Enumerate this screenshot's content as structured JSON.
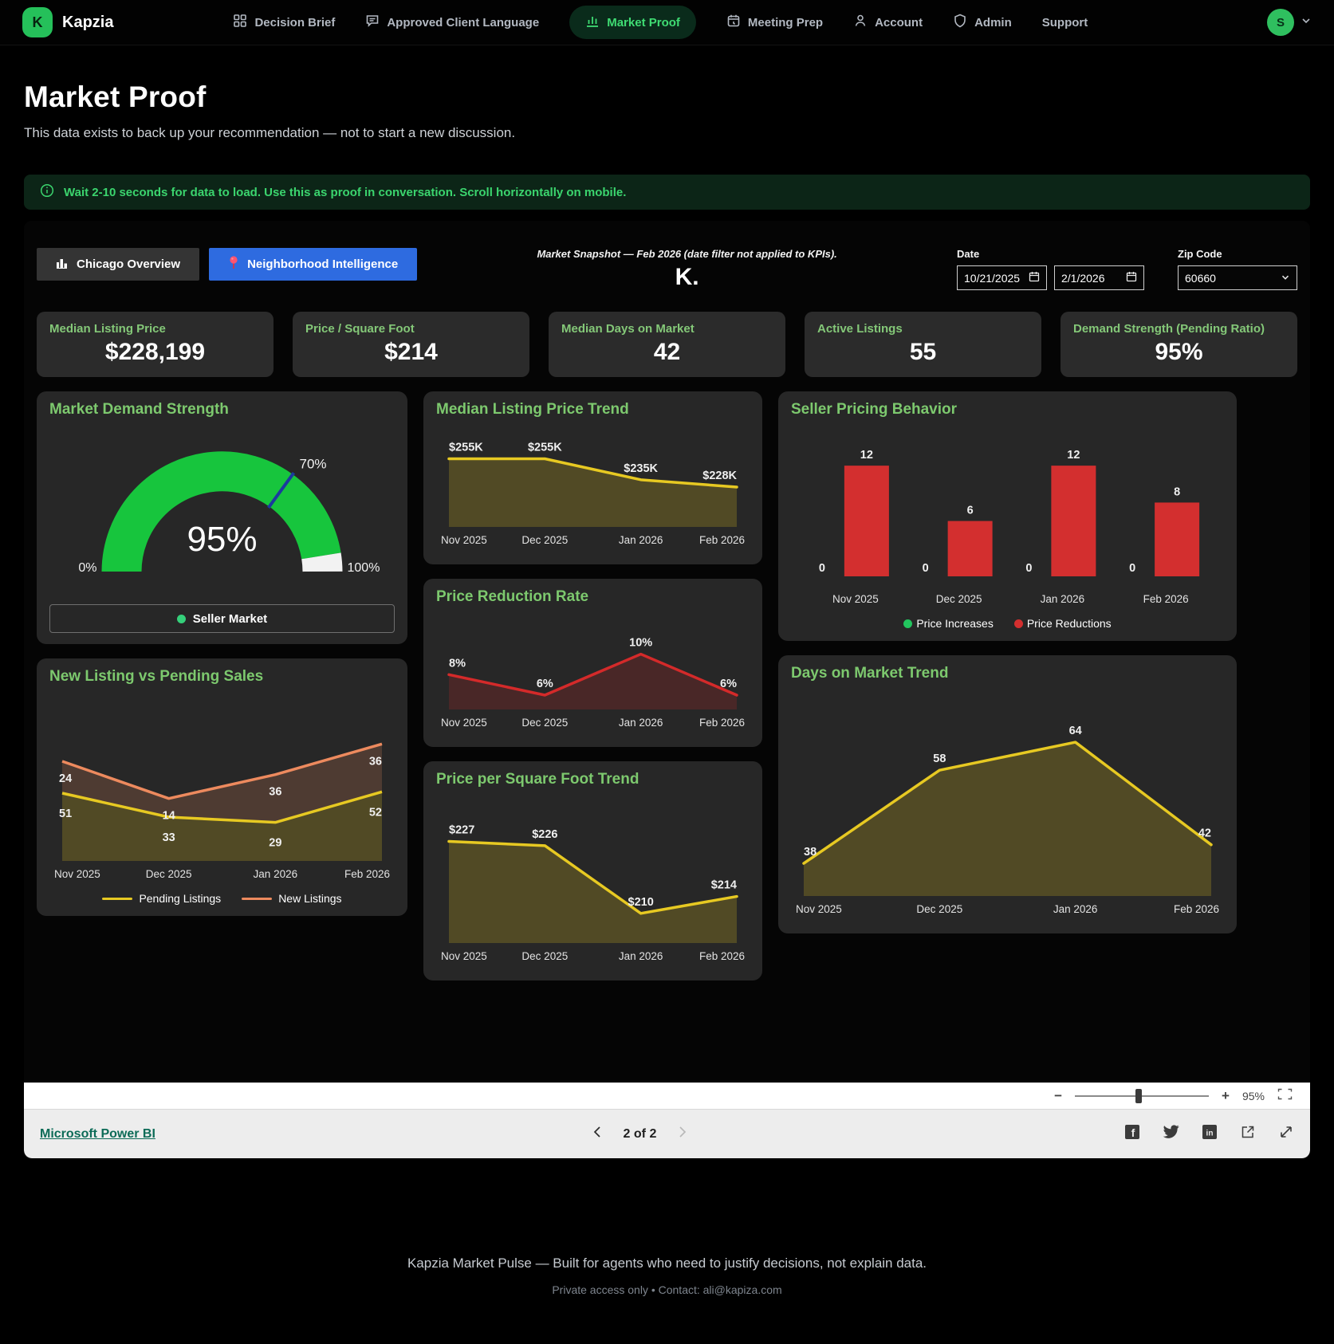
{
  "nav": {
    "brand": "Kapzia",
    "brand_initial": "K",
    "items": [
      {
        "label": "Decision Brief"
      },
      {
        "label": "Approved Client Language"
      },
      {
        "label": "Market Proof",
        "active": true
      },
      {
        "label": "Meeting Prep"
      },
      {
        "label": "Account"
      },
      {
        "label": "Admin"
      },
      {
        "label": "Support"
      }
    ],
    "avatar_initial": "S"
  },
  "header": {
    "title": "Market Proof",
    "subtitle": "This data exists to back up your recommendation — not to start a new discussion."
  },
  "banner": {
    "text": "Wait 2-10 seconds for data to load. Use this as proof in conversation. Scroll horizontally on mobile."
  },
  "report": {
    "tabs": [
      {
        "label": "Chicago Overview"
      },
      {
        "label": "Neighborhood Intelligence",
        "active": true
      }
    ],
    "snapshot_caption": "Market Snapshot — Feb 2026 (date filter not applied to KPIs).",
    "snapshot_mark": "K.",
    "filters": {
      "date_label": "Date",
      "date_from": "10/21/2025",
      "date_to": "2/1/2026",
      "zip_label": "Zip Code",
      "zip_value": "60660"
    },
    "kpis": [
      {
        "label": "Median Listing Price",
        "value": "$228,199"
      },
      {
        "label": "Price / Square Foot",
        "value": "$214"
      },
      {
        "label": "Median Days on Market",
        "value": "42"
      },
      {
        "label": "Active Listings",
        "value": "55"
      },
      {
        "label": "Demand Strength (Pending Ratio)",
        "value": "95%"
      }
    ]
  },
  "chart_data": [
    {
      "id": "gauge",
      "type": "gauge",
      "title": "Market Demand Strength",
      "value": 95,
      "target": 70,
      "value_label": "95%",
      "target_label": "70%",
      "min_label": "0%",
      "max_label": "100%",
      "legend": "Seller Market",
      "color": "#17c53d",
      "rest_color": "#f2f2f2",
      "target_color": "#1b3a9e"
    },
    {
      "id": "median-price",
      "type": "area",
      "title": "Median Listing Price Trend",
      "x": [
        "Nov 2025",
        "Dec 2025",
        "Jan 2026",
        "Feb 2026"
      ],
      "values": [
        255,
        255,
        235,
        228
      ],
      "labels": [
        "$255K",
        "$255K",
        "$235K",
        "$228K"
      ],
      "ylim": [
        190,
        263
      ],
      "color": "#e7c922",
      "fill": "rgba(231,201,34,0.22)"
    },
    {
      "id": "seller-pricing",
      "type": "bar",
      "title": "Seller Pricing Behavior",
      "x": [
        "Nov 2025",
        "Dec 2025",
        "Jan 2026",
        "Feb 2026"
      ],
      "series": [
        {
          "name": "Price Increases",
          "color": "#22c55e",
          "values": [
            0,
            0,
            0,
            0
          ]
        },
        {
          "name": "Price Reductions",
          "color": "#d32f2f",
          "values": [
            12,
            6,
            12,
            8
          ]
        }
      ],
      "ylim": [
        0,
        14
      ],
      "legend_position": "bottom"
    },
    {
      "id": "reduction-rate",
      "type": "area",
      "title": "Price Reduction Rate",
      "x": [
        "Nov 2025",
        "Dec 2025",
        "Jan 2026",
        "Feb 2026"
      ],
      "values": [
        8,
        6,
        10,
        6
      ],
      "labels": [
        "8%",
        "6%",
        "10%",
        "6%"
      ],
      "ylim": [
        4.6,
        11.6
      ],
      "color": "#d42a2a",
      "fill": "rgba(212,42,42,0.20)"
    },
    {
      "id": "new-pending",
      "type": "stacked-area",
      "title": "New Listing vs Pending Sales",
      "x": [
        "Nov 2025",
        "Dec 2025",
        "Jan 2026",
        "Feb 2026"
      ],
      "series": [
        {
          "name": "Pending Listings",
          "color": "#e7c922",
          "fill": "rgba(231,201,34,0.22)",
          "values": [
            51,
            33,
            29,
            52
          ],
          "labels": [
            "51",
            "33",
            "29",
            "52"
          ]
        },
        {
          "name": "New Listings",
          "color": "#ed8a5e",
          "fill": "rgba(237,138,94,0.20)",
          "values": [
            24,
            14,
            36,
            36
          ],
          "labels": [
            "24",
            "14",
            "36",
            "36"
          ]
        }
      ],
      "ylim": [
        0,
        108
      ],
      "legend_position": "bottom"
    },
    {
      "id": "ppsf",
      "type": "area",
      "title": "Price per Square Foot Trend",
      "x": [
        "Nov 2025",
        "Dec 2025",
        "Jan 2026",
        "Feb 2026"
      ],
      "values": [
        227,
        226,
        210,
        214
      ],
      "labels": [
        "$227",
        "$226",
        "$210",
        "$214"
      ],
      "ylim": [
        203,
        232
      ],
      "color": "#e7c922",
      "fill": "rgba(231,201,34,0.22)"
    },
    {
      "id": "dom-trend",
      "type": "area",
      "title": "Days on Market Trend",
      "x": [
        "Nov 2025",
        "Dec 2025",
        "Jan 2026",
        "Feb 2026"
      ],
      "values": [
        38,
        58,
        64,
        42
      ],
      "labels": [
        "38",
        "58",
        "64",
        "42"
      ],
      "ylim": [
        31,
        70
      ],
      "color": "#e7c922",
      "fill": "rgba(231,201,34,0.22)"
    }
  ],
  "powerbar": {
    "zoom_value": "95%",
    "link_label": "Microsoft Power BI",
    "page_label": "2 of 2"
  },
  "footer": {
    "line1": "Kapzia Market Pulse — Built for agents who need to justify decisions, not explain data.",
    "line2": "Private access only • Contact: ali@kapiza.com"
  },
  "colors": {
    "accent_green": "#3fdc73",
    "kpi_label_green": "#84c878",
    "chart_title_green": "#7dc96e",
    "gauge_green": "#17c53d",
    "target_blue": "#1b3a9e",
    "line_yellow": "#e7c922",
    "line_orange": "#ed8a5e",
    "line_red": "#d42a2a",
    "bar_red": "#d32f2f",
    "tab_blue": "#2e6be0",
    "pbi_link_teal": "#0c6b57"
  }
}
